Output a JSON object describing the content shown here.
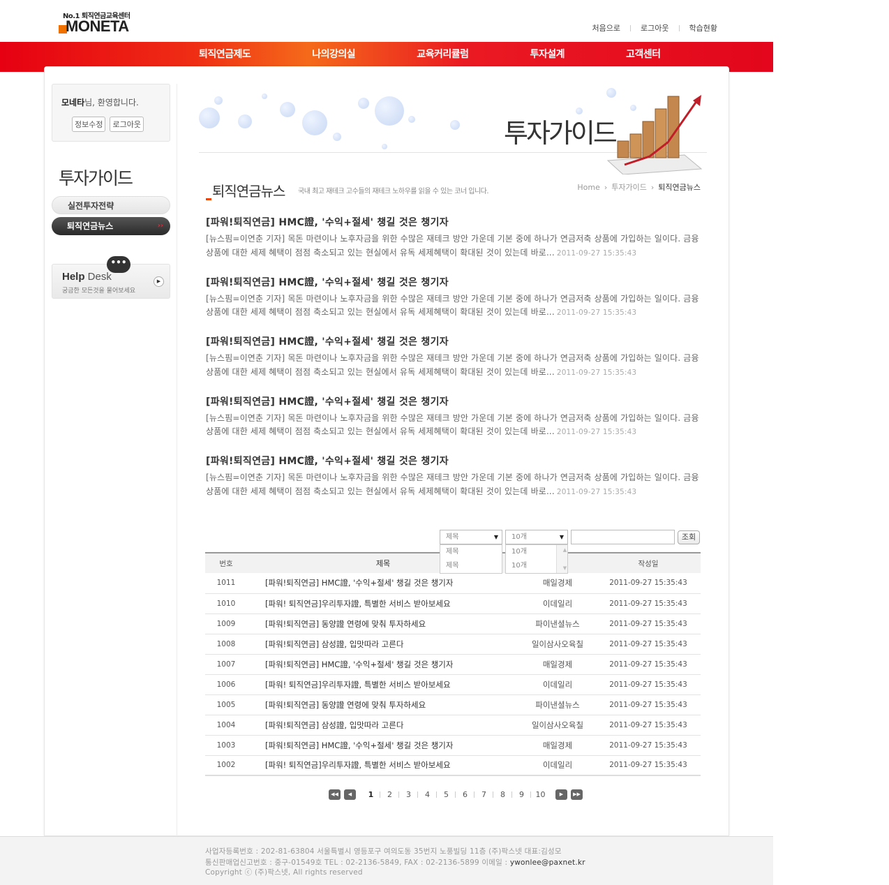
{
  "logo": {
    "tagline": "No.1 퇴직연금교육센터",
    "name": "MONETA"
  },
  "top_links": [
    "처음으로",
    "로그아웃",
    "학습현황"
  ],
  "gnb": [
    "퇴직연금제도",
    "나의강의실",
    "교육커리큘럼",
    "투자설계",
    "고객센터"
  ],
  "welcome": {
    "name": "모네타",
    "suffix": "님, 환영합니다.",
    "edit": "정보수정",
    "logout": "로그아웃"
  },
  "lnb": {
    "title": "투자가이드",
    "items": [
      {
        "label": "실전투자전략",
        "active": false
      },
      {
        "label": "퇴직연금뉴스",
        "active": true
      }
    ],
    "active_marker": "››"
  },
  "helpdesk": {
    "title_bold": "Help",
    "title": " Desk",
    "sub": "궁금한 모든것을 물어보세요"
  },
  "visual": {
    "title": "투자가이드"
  },
  "page": {
    "title": "퇴직연금뉴스",
    "description": "국내 최고 재테크 고수들의 재테크 노하우를 읽을 수 있는 코너 입니다.",
    "breadcrumb": [
      "Home",
      "투자가이드",
      "퇴직연금뉴스"
    ]
  },
  "news": [
    {
      "title": "[파워!퇴직연금] HMC證, '수익+절세' 챙길 것은 챙기자",
      "body": "[뉴스핌=이연춘 기자] 목돈 마련이나 노후자금을 위한 수많은 재테크 방안 가운데 기본 중에 하나가 연금저축 상품에 가입하는 일이다. 금융상품에 대한 세제 혜택이 점점 축소되고 있는 현실에서 유독 세제혜택이 확대된 것이 있는데 바로...",
      "date": "2011-09-27 15:35:43"
    },
    {
      "title": "[파워!퇴직연금] HMC證, '수익+절세' 챙길 것은 챙기자",
      "body": "[뉴스핌=이연춘 기자] 목돈 마련이나 노후자금을 위한 수많은 재테크 방안 가운데 기본 중에 하나가 연금저축 상품에 가입하는 일이다. 금융상품에 대한 세제 혜택이 점점 축소되고 있는 현실에서 유독 세제혜택이 확대된 것이 있는데 바로...",
      "date": "2011-09-27 15:35:43"
    },
    {
      "title": "[파워!퇴직연금] HMC證, '수익+절세' 챙길 것은 챙기자",
      "body": "[뉴스핌=이연춘 기자] 목돈 마련이나 노후자금을 위한 수많은 재테크 방안 가운데 기본 중에 하나가 연금저축 상품에 가입하는 일이다. 금융상품에 대한 세제 혜택이 점점 축소되고 있는 현실에서 유독 세제혜택이 확대된 것이 있는데 바로...",
      "date": "2011-09-27 15:35:43"
    },
    {
      "title": "[파워!퇴직연금] HMC證, '수익+절세' 챙길 것은 챙기자",
      "body": "[뉴스핌=이연춘 기자] 목돈 마련이나 노후자금을 위한 수많은 재테크 방안 가운데 기본 중에 하나가 연금저축 상품에 가입하는 일이다. 금융상품에 대한 세제 혜택이 점점 축소되고 있는 현실에서 유독 세제혜택이 확대된 것이 있는데 바로...",
      "date": "2011-09-27 15:35:43"
    },
    {
      "title": "[파워!퇴직연금] HMC證, '수익+절세' 챙길 것은 챙기자",
      "body": "[뉴스핌=이연춘 기자] 목돈 마련이나 노후자금을 위한 수많은 재테크 방안 가운데 기본 중에 하나가 연금저축 상품에 가입하는 일이다. 금융상품에 대한 세제 혜택이 점점 축소되고 있는 현실에서 유독 세제혜택이 확대된 것이 있는데 바로...",
      "date": "2011-09-27 15:35:43"
    }
  ],
  "search": {
    "field": {
      "selected": "제목",
      "options": [
        "제목",
        "제목"
      ]
    },
    "count": {
      "selected": "10개",
      "options": [
        "10개",
        "10개"
      ]
    },
    "keyword": "",
    "button": "조회"
  },
  "board": {
    "headers": [
      "번호",
      "제목",
      "",
      "작성일"
    ],
    "rows": [
      {
        "no": "1011",
        "title": "[파워!퇴직연금] HMC證, '수익+절세' 챙길 것은 챙기자",
        "source": "매일경제",
        "date": "2011-09-27 15:35:43"
      },
      {
        "no": "1010",
        "title": "[파워! 퇴직연금]우리투자證, 특별한 서비스 받아보세요",
        "source": "이데일리",
        "date": "2011-09-27 15:35:43"
      },
      {
        "no": "1009",
        "title": "[파워!퇴직연금] 동양證 연령에 맞춰 투자하세요",
        "source": "파이낸셜뉴스",
        "date": "2011-09-27 15:35:43"
      },
      {
        "no": "1008",
        "title": "[파워!퇴직연금] 삼성證, 입맛따라 고른다",
        "source": "일이삼사오육칠",
        "date": "2011-09-27 15:35:43"
      },
      {
        "no": "1007",
        "title": "[파워!퇴직연금] HMC證, '수익+절세' 챙길 것은 챙기자",
        "source": "매일경제",
        "date": "2011-09-27 15:35:43"
      },
      {
        "no": "1006",
        "title": "[파워! 퇴직연금]우리투자證, 특별한 서비스 받아보세요",
        "source": "이데일리",
        "date": "2011-09-27 15:35:43"
      },
      {
        "no": "1005",
        "title": "[파워!퇴직연금] 동양證 연령에 맞춰 투자하세요",
        "source": "파이낸셜뉴스",
        "date": "2011-09-27 15:35:43"
      },
      {
        "no": "1004",
        "title": "[파워!퇴직연금] 삼성證, 입맛따라 고른다",
        "source": "일이삼사오육칠",
        "date": "2011-09-27 15:35:43"
      },
      {
        "no": "1003",
        "title": "[파워!퇴직연금] HMC證, '수익+절세' 챙길 것은 챙기자",
        "source": "매일경제",
        "date": "2011-09-27 15:35:43"
      },
      {
        "no": "1002",
        "title": "[파워! 퇴직연금]우리투자證, 특별한 서비스 받아보세요",
        "source": "이데일리",
        "date": "2011-09-27 15:35:43"
      }
    ]
  },
  "paging": {
    "pages": [
      "1",
      "2",
      "3",
      "4",
      "5",
      "6",
      "7",
      "8",
      "9",
      "10"
    ],
    "current": "1"
  },
  "footer": {
    "line1": "사업자등록번호 : 202-81-63804 서울특별시 영등포구 여의도동 35번지 노풍빌딩 11층 (주)팍스넷 대표:김성모",
    "line2": "통신판매업신고번호 : 중구-01549호 TEL : 02-2136-5849, FAX : 02-2136-5899 이메일 : ",
    "email": "ywonlee@paxnet.kr",
    "line3": "Copyright ⓒ (주)팍스넷, All rights reserved"
  },
  "colors": {
    "gnb_red": "#e60012",
    "accent_orange": "#f07000"
  }
}
